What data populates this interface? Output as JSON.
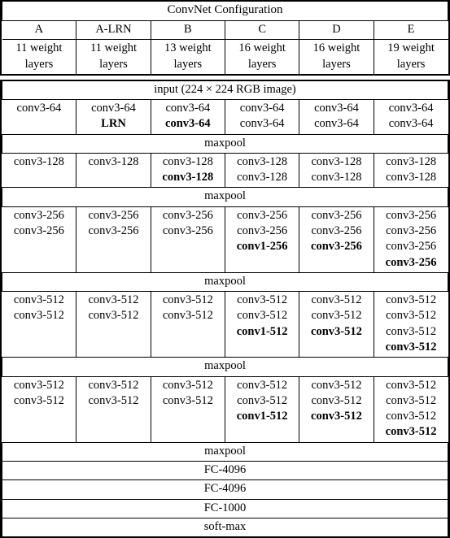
{
  "document": {
    "kind": "paper-table",
    "title": "ConvNet Configuration",
    "font_color": "#000000",
    "background_color": "#ffffff"
  },
  "header": {
    "title": "ConvNet Configuration",
    "columns": [
      {
        "name": "A",
        "weights": "11 weight layers"
      },
      {
        "name": "A-LRN",
        "weights": "11 weight layers"
      },
      {
        "name": "B",
        "weights": "13 weight layers"
      },
      {
        "name": "C",
        "weights": "16 weight layers"
      },
      {
        "name": "D",
        "weights": "16 weight layers"
      },
      {
        "name": "E",
        "weights": "19 weight layers"
      }
    ],
    "weights_line1": [
      "11 weight",
      "11 weight",
      "13 weight",
      "16 weight",
      "16 weight",
      "19 weight"
    ],
    "weights_line2": [
      "layers",
      "layers",
      "layers",
      "layers",
      "layers",
      "layers"
    ]
  },
  "body": {
    "input_row": "input (224 × 224 RGB image)",
    "maxpool_label": "maxpool",
    "blocks": [
      {
        "id": "conv64",
        "columns": [
          [
            {
              "text": "conv3-64",
              "bold": false
            }
          ],
          [
            {
              "text": "conv3-64",
              "bold": false
            },
            {
              "text": "LRN",
              "bold": true
            }
          ],
          [
            {
              "text": "conv3-64",
              "bold": false
            },
            {
              "text": "conv3-64",
              "bold": true
            }
          ],
          [
            {
              "text": "conv3-64",
              "bold": false
            },
            {
              "text": "conv3-64",
              "bold": false
            }
          ],
          [
            {
              "text": "conv3-64",
              "bold": false
            },
            {
              "text": "conv3-64",
              "bold": false
            }
          ],
          [
            {
              "text": "conv3-64",
              "bold": false
            },
            {
              "text": "conv3-64",
              "bold": false
            }
          ]
        ]
      },
      {
        "id": "conv128",
        "columns": [
          [
            {
              "text": "conv3-128",
              "bold": false
            }
          ],
          [
            {
              "text": "conv3-128",
              "bold": false
            }
          ],
          [
            {
              "text": "conv3-128",
              "bold": false
            },
            {
              "text": "conv3-128",
              "bold": true
            }
          ],
          [
            {
              "text": "conv3-128",
              "bold": false
            },
            {
              "text": "conv3-128",
              "bold": false
            }
          ],
          [
            {
              "text": "conv3-128",
              "bold": false
            },
            {
              "text": "conv3-128",
              "bold": false
            }
          ],
          [
            {
              "text": "conv3-128",
              "bold": false
            },
            {
              "text": "conv3-128",
              "bold": false
            }
          ]
        ]
      },
      {
        "id": "conv256",
        "columns": [
          [
            {
              "text": "conv3-256",
              "bold": false
            },
            {
              "text": "conv3-256",
              "bold": false
            }
          ],
          [
            {
              "text": "conv3-256",
              "bold": false
            },
            {
              "text": "conv3-256",
              "bold": false
            }
          ],
          [
            {
              "text": "conv3-256",
              "bold": false
            },
            {
              "text": "conv3-256",
              "bold": false
            }
          ],
          [
            {
              "text": "conv3-256",
              "bold": false
            },
            {
              "text": "conv3-256",
              "bold": false
            },
            {
              "text": "conv1-256",
              "bold": true
            }
          ],
          [
            {
              "text": "conv3-256",
              "bold": false
            },
            {
              "text": "conv3-256",
              "bold": false
            },
            {
              "text": "conv3-256",
              "bold": true
            }
          ],
          [
            {
              "text": "conv3-256",
              "bold": false
            },
            {
              "text": "conv3-256",
              "bold": false
            },
            {
              "text": "conv3-256",
              "bold": false
            },
            {
              "text": "conv3-256",
              "bold": true
            }
          ]
        ]
      },
      {
        "id": "conv512-a",
        "columns": [
          [
            {
              "text": "conv3-512",
              "bold": false
            },
            {
              "text": "conv3-512",
              "bold": false
            }
          ],
          [
            {
              "text": "conv3-512",
              "bold": false
            },
            {
              "text": "conv3-512",
              "bold": false
            }
          ],
          [
            {
              "text": "conv3-512",
              "bold": false
            },
            {
              "text": "conv3-512",
              "bold": false
            }
          ],
          [
            {
              "text": "conv3-512",
              "bold": false
            },
            {
              "text": "conv3-512",
              "bold": false
            },
            {
              "text": "conv1-512",
              "bold": true
            }
          ],
          [
            {
              "text": "conv3-512",
              "bold": false
            },
            {
              "text": "conv3-512",
              "bold": false
            },
            {
              "text": "conv3-512",
              "bold": true
            }
          ],
          [
            {
              "text": "conv3-512",
              "bold": false
            },
            {
              "text": "conv3-512",
              "bold": false
            },
            {
              "text": "conv3-512",
              "bold": false
            },
            {
              "text": "conv3-512",
              "bold": true
            }
          ]
        ]
      },
      {
        "id": "conv512-b",
        "columns": [
          [
            {
              "text": "conv3-512",
              "bold": false
            },
            {
              "text": "conv3-512",
              "bold": false
            }
          ],
          [
            {
              "text": "conv3-512",
              "bold": false
            },
            {
              "text": "conv3-512",
              "bold": false
            }
          ],
          [
            {
              "text": "conv3-512",
              "bold": false
            },
            {
              "text": "conv3-512",
              "bold": false
            }
          ],
          [
            {
              "text": "conv3-512",
              "bold": false
            },
            {
              "text": "conv3-512",
              "bold": false
            },
            {
              "text": "conv1-512",
              "bold": true
            }
          ],
          [
            {
              "text": "conv3-512",
              "bold": false
            },
            {
              "text": "conv3-512",
              "bold": false
            },
            {
              "text": "conv3-512",
              "bold": true
            }
          ],
          [
            {
              "text": "conv3-512",
              "bold": false
            },
            {
              "text": "conv3-512",
              "bold": false
            },
            {
              "text": "conv3-512",
              "bold": false
            },
            {
              "text": "conv3-512",
              "bold": true
            }
          ]
        ]
      }
    ],
    "footer_rows": [
      "maxpool",
      "FC-4096",
      "FC-4096",
      "FC-1000",
      "soft-max"
    ]
  }
}
